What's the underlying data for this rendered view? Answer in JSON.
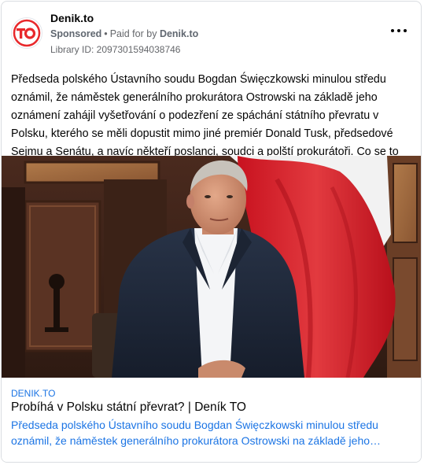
{
  "post": {
    "page_name": "Denik.to",
    "sponsored": "Sponsored",
    "paid_prefix": "Paid for by",
    "paid_by": "Denik.to",
    "library_id": "Library ID: 2097301594038746",
    "logo_text": "TO",
    "body": "Předseda polského Ústavního soudu Bogdan Święczkowski minulou středu oznámil, že náměstek generálního prokurátora Ostrowski na základě jeho oznámení zahájil vyšetřování o podezření ze spáchání státního převratu v Polsku, kterého se měli dopustit mimo jiné premiér Donald Tusk, předsedové Sejmu a Senátu, a navíc někteří poslanci, soudci a polští prokurátoři. Co se to děje?"
  },
  "link": {
    "domain": "DENIK.TO",
    "title": "Probíhá v Polsku státní převrat? | Deník TO",
    "description": "Předseda polského Ústavního soudu Bogdan Święczkowski minulou středu oznámil, že náměstek generálního prokurátora Ostrowski na základě jeho…"
  },
  "colors": {
    "brand_red": "#e8282b",
    "link_blue": "#1b74e4",
    "flag_red": "#dc1f2b"
  },
  "icons": {
    "more": "more-horizontal-icon",
    "logo": "denik-to-logo"
  }
}
